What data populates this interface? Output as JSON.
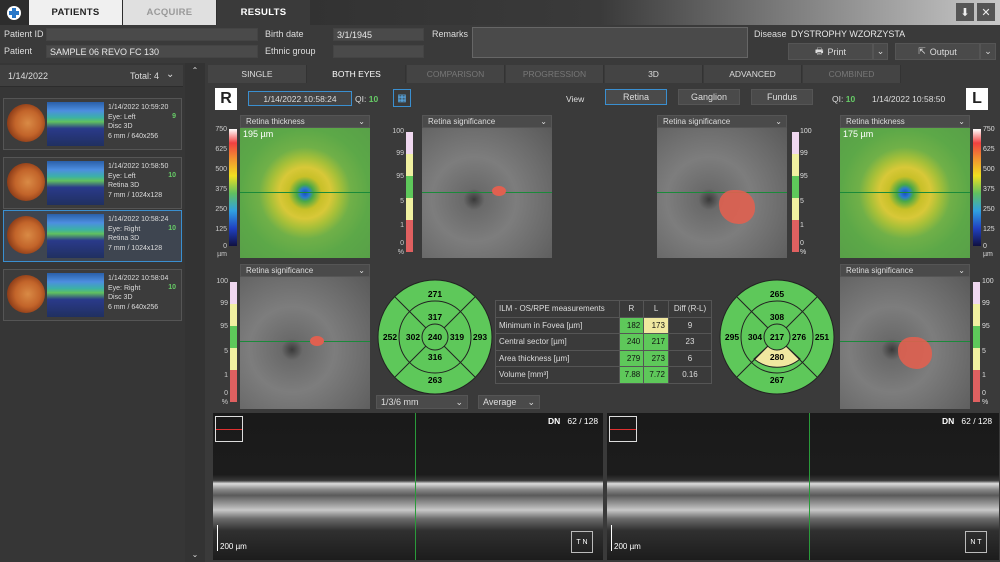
{
  "tabs": {
    "patients": "PATIENTS",
    "acquire": "ACQUIRE",
    "results": "RESULTS"
  },
  "patient": {
    "id_label": "Patient ID",
    "id_value": "",
    "patient_label": "Patient",
    "patient_value": "SAMPLE 06 REVO FC 130",
    "birth_label": "Birth date",
    "birth_value": "3/1/1945",
    "ethnic_label": "Ethnic group",
    "ethnic_value": "",
    "remarks_label": "Remarks",
    "remarks_value": "",
    "disease_label": "Disease",
    "disease_value": "DYSTROPHY  WZORZYSTA"
  },
  "actions": {
    "print": "Print",
    "output": "Output"
  },
  "sidebar": {
    "date": "1/14/2022",
    "total": "Total: 4",
    "exams": [
      {
        "datetime": "1/14/2022 10:59:20",
        "eye": "Eye: Left",
        "proto": "Disc 3D",
        "res": "6 mm / 640x256",
        "qi": "9"
      },
      {
        "datetime": "1/14/2022 10:58:50",
        "eye": "Eye: Left",
        "proto": "Retina 3D",
        "res": "7 mm / 1024x128",
        "qi": "10"
      },
      {
        "datetime": "1/14/2022 10:58:24",
        "eye": "Eye: Right",
        "proto": "Retina 3D",
        "res": "7 mm / 1024x128",
        "qi": "10"
      },
      {
        "datetime": "1/14/2022 10:58:04",
        "eye": "Eye: Right",
        "proto": "Disc 3D",
        "res": "6 mm / 640x256",
        "qi": "10"
      }
    ]
  },
  "subtabs": [
    "SINGLE",
    "BOTH EYES",
    "COMPARISON",
    "PROGRESSION",
    "3D",
    "ADVANCED",
    "COMBINED"
  ],
  "header": {
    "r": "R",
    "l": "L",
    "r_date": "1/14/2022 10:58:24",
    "l_date": "1/14/2022 10:58:50",
    "qi_label": "QI:",
    "r_qi": "10",
    "l_qi": "10",
    "view": "View",
    "views": [
      "Retina",
      "Ganglion",
      "Fundus"
    ]
  },
  "panels": {
    "thick": "Retina thickness",
    "sig": "Retina significance",
    "r_thick_val": "195 µm",
    "l_thick_val": "175 µm"
  },
  "thick_scale": [
    "750",
    "625",
    "500",
    "375",
    "250",
    "125",
    "0",
    "µm"
  ],
  "sig_scale": [
    "100",
    "99",
    "95",
    "5",
    "1",
    "0",
    "%"
  ],
  "grid_r": {
    "sup_outer": "271",
    "sup_inner": "317",
    "nas_outer": "252",
    "nas_inner": "302",
    "center": "240",
    "temp_inner": "319",
    "temp_outer": "293",
    "inf_inner": "316",
    "inf_outer": "263"
  },
  "grid_l": {
    "sup_outer": "265",
    "sup_inner": "308",
    "temp_outer": "295",
    "temp_inner": "304",
    "center": "217",
    "nas_inner": "276",
    "nas_outer": "251",
    "inf_inner": "280",
    "inf_outer": "267"
  },
  "measurements": {
    "title": "ILM - OS/RPE measurements",
    "r": "R",
    "l": "L",
    "diff": "Diff (R-L)",
    "rows": [
      {
        "name": "Minimum in Fovea [µm]",
        "r": "182",
        "l": "173",
        "d": "9"
      },
      {
        "name": "Central sector [µm]",
        "r": "240",
        "l": "217",
        "d": "23"
      },
      {
        "name": "Area thickness [µm]",
        "r": "279",
        "l": "273",
        "d": "6"
      },
      {
        "name": "Volume [mm³]",
        "r": "7.88",
        "l": "7.72",
        "d": "0.16"
      }
    ]
  },
  "selects": {
    "grid": "1/3/6 mm",
    "avg": "Average"
  },
  "bscan": {
    "label": "DN",
    "r_frame": "62 / 128",
    "l_frame": "62 / 128",
    "scale": "200 µm",
    "r_dir": "T  N",
    "l_dir": "N  T"
  },
  "colors": {
    "accent": "#3a8fd0",
    "green": "#5ec85a",
    "yellow": "#f0e8a0",
    "red": "#d85050",
    "qi": "#66cc66"
  }
}
